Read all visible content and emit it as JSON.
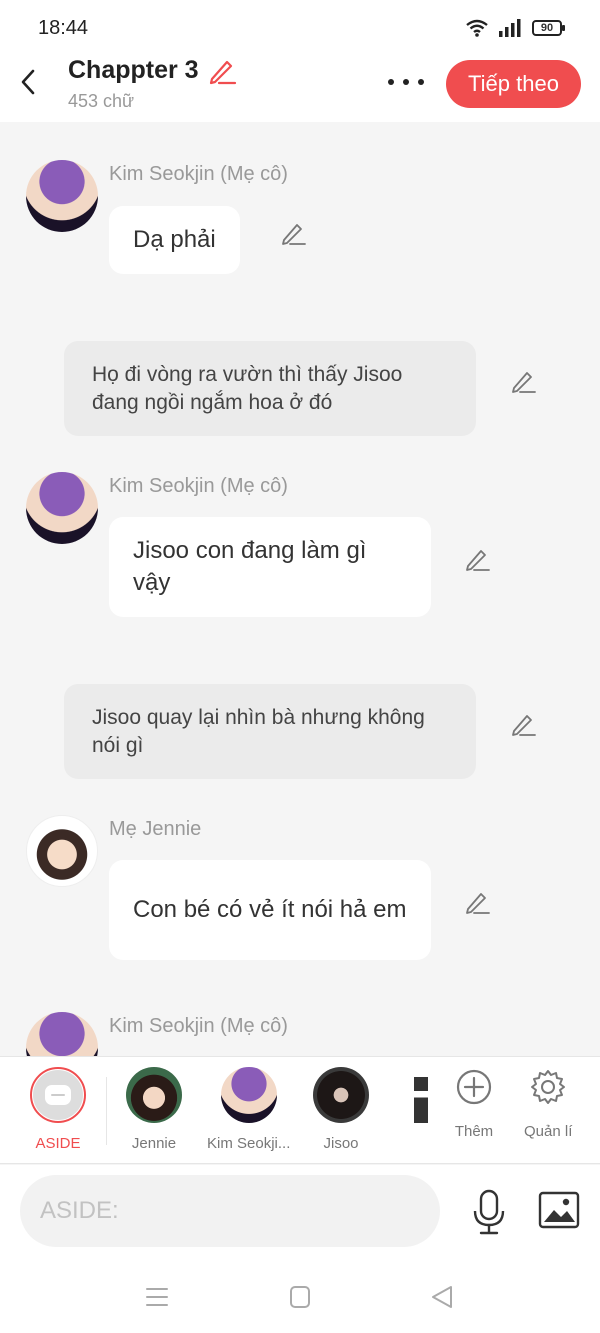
{
  "status_bar": {
    "time": "18:44",
    "battery": "90"
  },
  "header": {
    "back_icon": "chevron-left-icon",
    "title": "Chappter 3",
    "title_edit_icon": "pencil-icon",
    "word_count": "453 chữ",
    "more_icon": "more-horizontal-icon",
    "next_label": "Tiếp theo"
  },
  "colors": {
    "accent": "#f04d4f",
    "background": "#f5f5f5",
    "bubble": "#ffffff",
    "aside_bubble": "#ebebeb"
  },
  "messages": [
    {
      "type": "dialogue",
      "speaker": "Kim Seokjin (Mẹ cô)",
      "text": "Dạ phải"
    },
    {
      "type": "aside",
      "text": "Họ đi vòng ra vườn thì thấy Jisoo đang ngồi ngắm hoa ở đó"
    },
    {
      "type": "dialogue",
      "speaker": "Kim Seokjin (Mẹ cô)",
      "text": "Jisoo con đang làm gì vậy"
    },
    {
      "type": "aside",
      "text": "Jisoo quay lại nhìn bà nhưng không nói gì"
    },
    {
      "type": "dialogue",
      "speaker": "Mẹ Jennie",
      "text": "Con bé có vẻ ít nói hả em"
    },
    {
      "type": "dialogue",
      "speaker": "Kim Seokjin (Mẹ cô)",
      "text": ""
    }
  ],
  "characters": {
    "aside_label": "ASIDE",
    "items": [
      {
        "label": "Jennie"
      },
      {
        "label": "Kim Seokji..."
      },
      {
        "label": "Jisoo"
      }
    ],
    "add_label": "Thêm",
    "manage_label": "Quản lí"
  },
  "composer": {
    "placeholder": "ASIDE:"
  },
  "nav": {
    "menu_icon": "menu-icon",
    "home_icon": "square-icon",
    "back_icon": "triangle-back-icon"
  }
}
